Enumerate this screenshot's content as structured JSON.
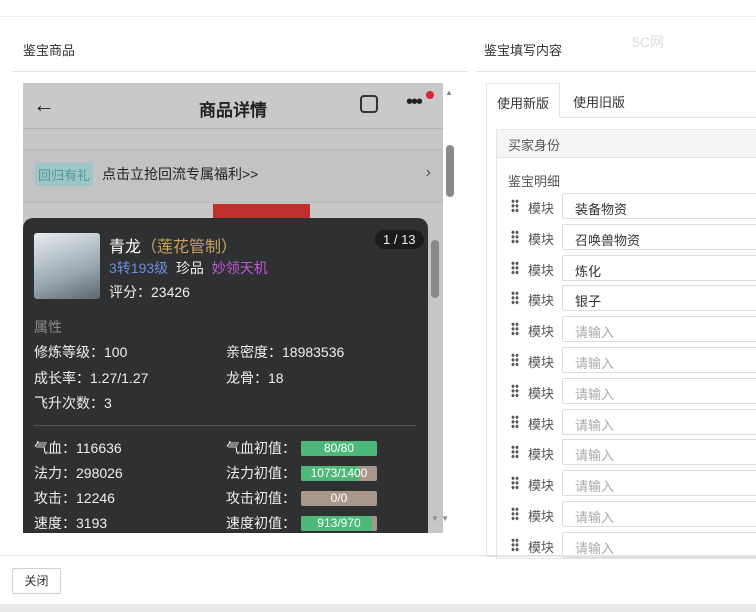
{
  "left": {
    "title": "鉴宝商品"
  },
  "right": {
    "title": "鉴宝填写内容"
  },
  "watermark": "5C网",
  "phone": {
    "header_title": "商品详情",
    "promo_tag": "回归有礼",
    "promo_text": "点击立抢回流专属福利>>",
    "card": {
      "name": "青龙",
      "name_suffix": "（莲花管制）",
      "level": "3转193级",
      "rarity": "珍品",
      "skill": "妙领天机",
      "score": "评分：23426",
      "pager": "1 / 13",
      "section": "属性",
      "attrs": [
        "修炼等级：100",
        "亲密度：18983536",
        "成长率：1.27/1.27",
        "龙骨：18",
        "飞升次数：3"
      ],
      "stats": [
        {
          "label": "气血：116636",
          "init_label": "气血初值：",
          "init": "80/80",
          "fill": 1.0
        },
        {
          "label": "法力：298026",
          "init_label": "法力初值：",
          "init": "1073/1400",
          "fill": 0.766
        },
        {
          "label": "攻击：12246",
          "init_label": "攻击初值：",
          "init": "0/0",
          "fill": 0
        },
        {
          "label": "速度：3193",
          "init_label": "速度初值：",
          "init": "913/970",
          "fill": 0.94
        }
      ]
    }
  },
  "tabs": [
    "使用新版",
    "使用旧版"
  ],
  "buyer_identity": "买家身份",
  "detail_title": "鉴宝明细",
  "module_label": "模块",
  "modules": [
    {
      "value": "装备物资"
    },
    {
      "value": "召唤兽物资"
    },
    {
      "value": "炼化"
    },
    {
      "value": "银子"
    },
    {
      "value": "",
      "placeholder": "请输入"
    },
    {
      "value": "",
      "placeholder": "请输入"
    },
    {
      "value": "",
      "placeholder": "请输入"
    },
    {
      "value": "",
      "placeholder": "请输入"
    },
    {
      "value": "",
      "placeholder": "请输入"
    },
    {
      "value": "",
      "placeholder": "请输入"
    },
    {
      "value": "",
      "placeholder": "请输入"
    },
    {
      "value": "",
      "placeholder": "请输入"
    }
  ],
  "footer": {
    "close": "关闭"
  }
}
